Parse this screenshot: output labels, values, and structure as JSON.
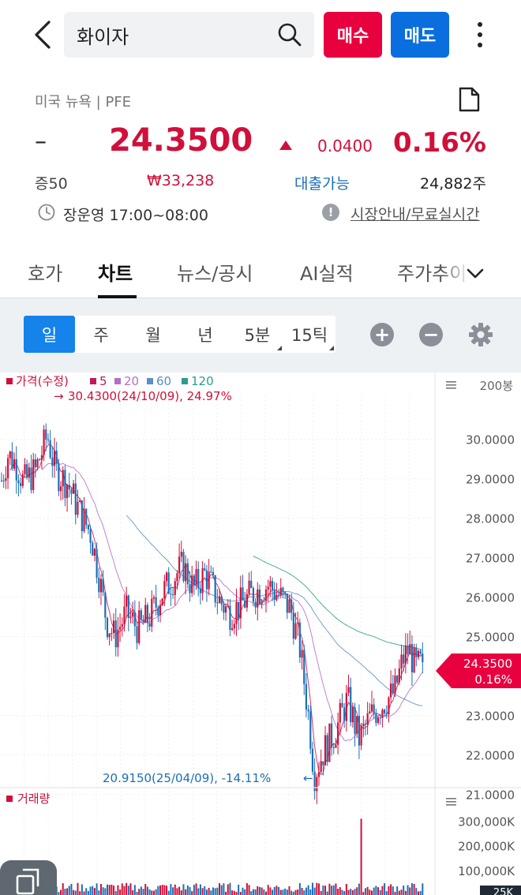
{
  "header": {
    "search_value": "화이자",
    "buy_label": "매수",
    "sell_label": "매도"
  },
  "stock": {
    "market": "미국 뉴욕 | PFE",
    "dash": "–",
    "price": "24.3500",
    "change": "0.0400",
    "change_pct": "0.16%",
    "margin": "증50",
    "krw_price": "₩33,238",
    "loan": "대출가능",
    "shares": "24,882주",
    "session": "장운영 17:00~08:00",
    "market_info": "시장안내/무료실시간"
  },
  "tabs": [
    {
      "label": "호가"
    },
    {
      "label": "차트",
      "active": true
    },
    {
      "label": "뉴스/공시"
    },
    {
      "label": "AI실적"
    },
    {
      "label": "주가추이"
    }
  ],
  "periods": [
    {
      "label": "일",
      "active": true
    },
    {
      "label": "주"
    },
    {
      "label": "월"
    },
    {
      "label": "년"
    },
    {
      "label": "5분",
      "dropdown": true
    },
    {
      "label": "15틱",
      "dropdown": true
    }
  ],
  "zoom": {
    "plus": "+",
    "minus": "−"
  },
  "colors": {
    "up": "#d0103a",
    "down": "#1b6fb4",
    "accent": "#1583e9",
    "ma5": "#c2185b",
    "ma20": "#b36fc8",
    "ma60": "#5b8fc7",
    "ma120": "#2a9d8f"
  },
  "chart_data": {
    "type": "candlestick",
    "legend": {
      "price_label": "가격(수정)",
      "ma": [
        "5",
        "20",
        "60",
        "120"
      ]
    },
    "bars_label": "200봉",
    "yticks": [
      "30.0000",
      "29.0000",
      "28.0000",
      "27.0000",
      "26.0000",
      "25.0000",
      "23.0000",
      "22.0000",
      "21.0000"
    ],
    "ylim": [
      20.55,
      30.85
    ],
    "high_annotation": "30.4300(24/10/09), 24.97%",
    "low_annotation": "20.9150(25/04/09), -14.11%",
    "high_value": 30.43,
    "low_value": 20.915,
    "current_value": 24.35,
    "current_label": "24.3500",
    "current_pct": "0.16%",
    "volume_label": "거래량",
    "volume_ticks": [
      "300,000K",
      "200,000K",
      "100,000K",
      "25K"
    ],
    "volume_ylim": [
      0,
      340000
    ]
  }
}
